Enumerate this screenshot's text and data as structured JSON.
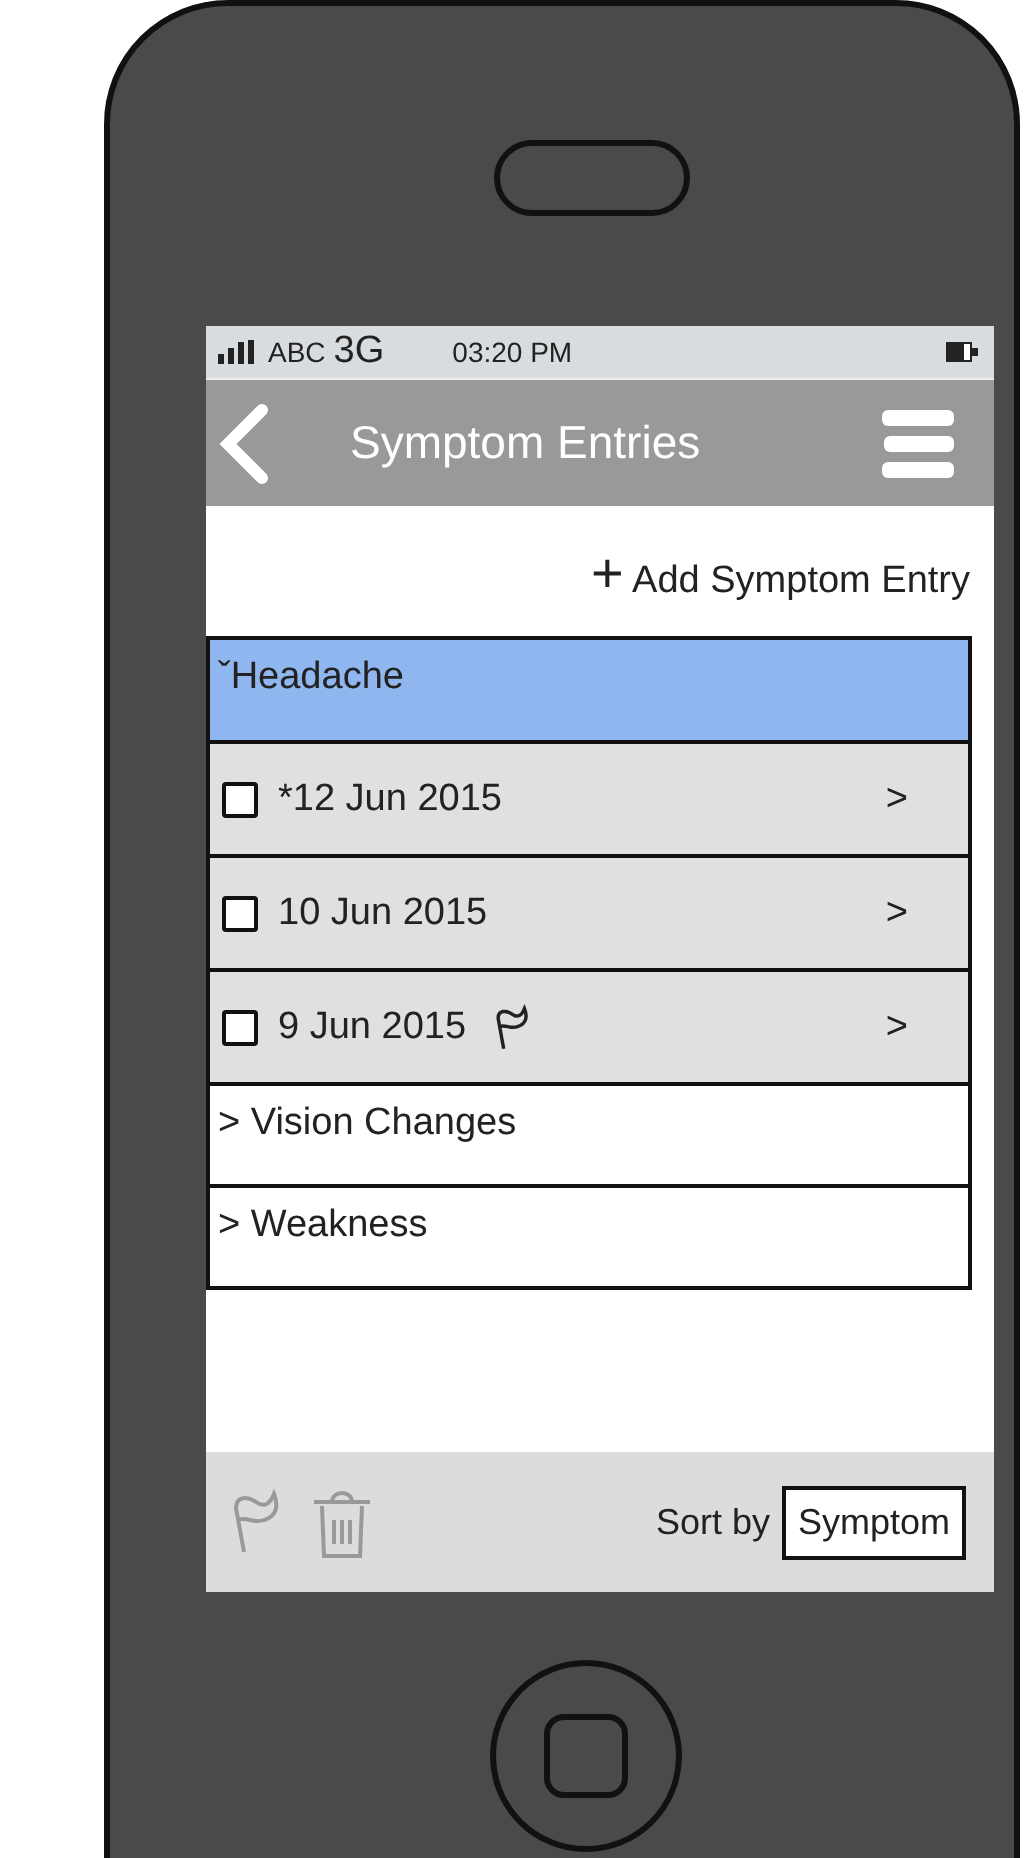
{
  "status_bar": {
    "carrier": "ABC",
    "network": "3G",
    "time": "03:20 PM"
  },
  "nav_bar": {
    "title": "Symptom Entries"
  },
  "add_action": {
    "icon": "+",
    "label": "Add Symptom Entry"
  },
  "symptoms": [
    {
      "expander": "ˇ",
      "label": "Headache",
      "selected": true,
      "entries": [
        {
          "date": "*12 Jun 2015",
          "checked": false,
          "flagged": false,
          "chevron": ">"
        },
        {
          "date": "10 Jun 2015",
          "checked": false,
          "flagged": false,
          "chevron": ">"
        },
        {
          "date": "9 Jun 2015",
          "checked": false,
          "flagged": true,
          "chevron": ">"
        }
      ]
    },
    {
      "expander": ">",
      "label": "Vision Changes",
      "selected": false
    },
    {
      "expander": ">",
      "label": "Weakness",
      "selected": false
    }
  ],
  "toolbar": {
    "flag_disabled": true,
    "delete_disabled": true,
    "sort_label": "Sort by",
    "sort_value": "Symptom"
  }
}
